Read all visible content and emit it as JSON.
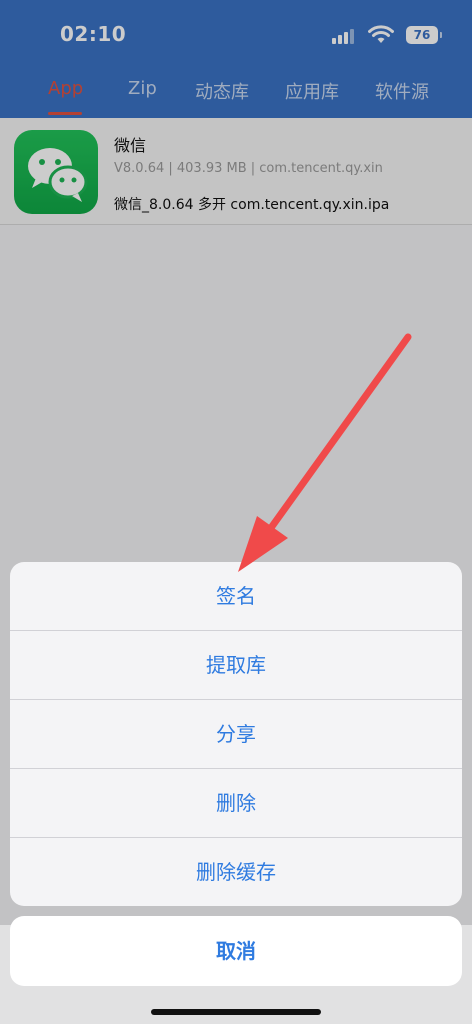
{
  "status_bar": {
    "time": "02:10",
    "battery": "76"
  },
  "tabs": [
    {
      "label": "App",
      "active": true
    },
    {
      "label": "Zip",
      "active": false
    },
    {
      "label": "动态库",
      "active": false
    },
    {
      "label": "应用库",
      "active": false
    },
    {
      "label": "软件源",
      "active": false
    }
  ],
  "app": {
    "name": "微信",
    "meta": "V8.0.64 | 403.93 MB | com.tencent.qy.xin",
    "file": "微信_8.0.64 多开 com.tencent.qy.xin.ipa",
    "icon": "wechat-icon"
  },
  "action_sheet": {
    "items": [
      {
        "label": "签名"
      },
      {
        "label": "提取库"
      },
      {
        "label": "分享"
      },
      {
        "label": "删除"
      },
      {
        "label": "删除缓存"
      }
    ],
    "cancel_label": "取消"
  },
  "colors": {
    "header": "#3a72c5",
    "active_tab": "#e05240",
    "action": "#2f7be0",
    "annotation_arrow": "#f04a4a"
  }
}
